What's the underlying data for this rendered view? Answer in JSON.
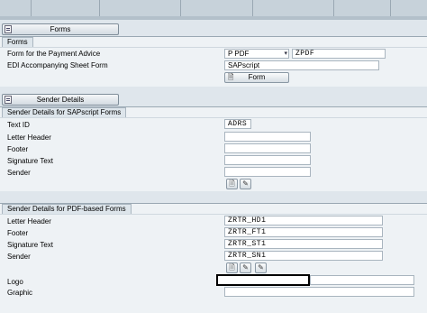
{
  "forms_section": {
    "toggle_label": "Forms",
    "tab_label": "Forms",
    "rows": {
      "payment_advice_label": "Form for the Payment Advice",
      "payment_advice_type": "P PDF",
      "payment_advice_form": "ZPDF",
      "edi_label": "EDI Accompanying Sheet Form",
      "edi_value": "SAPscript"
    },
    "form_button_label": "Form"
  },
  "sender_details_sapscript": {
    "toggle_label": "Sender Details",
    "tab_label": "Sender Details for SAPscript Forms",
    "rows": {
      "text_id_label": "Text ID",
      "text_id_value": "ADRS",
      "letter_header_label": "Letter Header",
      "letter_header_value": "",
      "footer_label": "Footer",
      "footer_value": "",
      "signature_label": "Signature Text",
      "signature_value": "",
      "sender_label": "Sender",
      "sender_value": ""
    }
  },
  "sender_details_pdf": {
    "tab_label": "Sender Details for PDF-based Forms",
    "rows": {
      "letter_header_label": "Letter Header",
      "letter_header_value": "ZRTR_HD1",
      "footer_label": "Footer",
      "footer_value": "ZRTR_FT1",
      "signature_label": "Signature Text",
      "signature_value": "ZRTR_ST1",
      "sender_label": "Sender",
      "sender_value": "ZRTR_SN1",
      "logo_label": "Logo",
      "logo_value": "",
      "graphic_label": "Graphic",
      "graphic_value": ""
    }
  },
  "icons": {
    "toggle": "screen-toggle-icon",
    "form": "form-icon",
    "create": "create-document-icon",
    "change": "edit-pencil-icon",
    "dropdown": "dropdown-arrow-icon"
  }
}
